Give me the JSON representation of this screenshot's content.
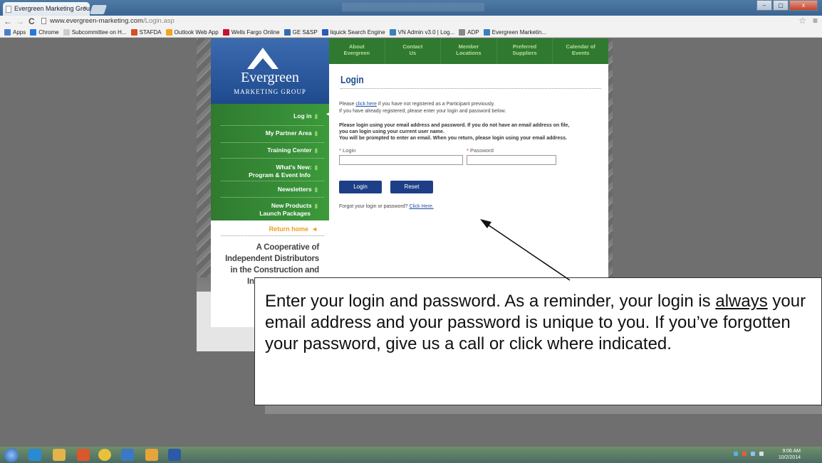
{
  "browser": {
    "tab_title": "Evergreen Marketing Grou",
    "tab_close": "×",
    "back": "←",
    "forward": "→",
    "reload": "C",
    "url_host": "www.evergreen-marketing.com",
    "url_path": "/Login.asp",
    "star": "☆",
    "menu": "≡",
    "win_minimize": "–",
    "win_maximize": "▢",
    "win_close": "x"
  },
  "bookmarks": [
    {
      "label": "Apps",
      "color": "#4a7bd0"
    },
    {
      "label": "Chrome",
      "color": "#2a78d6"
    },
    {
      "label": "Subcommittee on H...",
      "color": "#cccccc"
    },
    {
      "label": "STAFDA",
      "color": "#d44e2a"
    },
    {
      "label": "Outlook Web App",
      "color": "#f3a41c"
    },
    {
      "label": "Wells Fargo Online",
      "color": "#c8102e"
    },
    {
      "label": "GE S&SP",
      "color": "#2f6db0"
    },
    {
      "label": "liquick Search Engine",
      "color": "#2a5bb8"
    },
    {
      "label": "VN Admin v3.0 | Log...",
      "color": "#3a7fc0"
    },
    {
      "label": "ADP",
      "color": "#888888"
    },
    {
      "label": "Evergreen Marketin...",
      "color": "#3a7fc0"
    }
  ],
  "logo": {
    "title": "Evergreen",
    "subtitle": "MARKETING GROUP"
  },
  "top_nav": [
    {
      "line1": "About",
      "line2": "Evergreen"
    },
    {
      "line1": "Contact",
      "line2": "Us"
    },
    {
      "line1": "Member",
      "line2": "Locations"
    },
    {
      "line1": "Preferred",
      "line2": "Suppliers"
    },
    {
      "line1": "Calendar of",
      "line2": "Events"
    }
  ],
  "side_menu": [
    {
      "label": "Log in"
    },
    {
      "label": "My Partner Area"
    },
    {
      "label": "Training Center"
    },
    {
      "label": "What's New:",
      "label2": "Program & Event Info"
    },
    {
      "label": "Newsletters"
    },
    {
      "label": "New Products",
      "label2": "Launch Packages"
    }
  ],
  "return_home": "Return home",
  "tagline": "A Cooperative of Independent Distributors in the Construction and Industrial Products",
  "login": {
    "title": "Login",
    "para1_pre": "Please ",
    "para1_link": "click here",
    "para1_post": " if you have not registered as a Participant previously.",
    "para2": "If you have already registered, please enter your login and password below.",
    "bold1": "Please login using your email address and password. If you do not have an email address on file,",
    "bold2": "you can login using your current user name.",
    "bold3": "You will be prompted to enter an email. When you return, please login using your email address.",
    "required_mark": "*",
    "login_label": "Login",
    "password_label": "Password",
    "login_button": "Login",
    "reset_button": "Reset",
    "forgot_pre": "Forgot your login or password? ",
    "forgot_link": "Click Here."
  },
  "callout": {
    "text1": "Enter your login and password. As a reminder, your login is ",
    "emphasis": "always",
    "text2": " your email address and your password is unique to you. If you’ve forgotten your password, give us a call or click where indicated."
  },
  "tray": {
    "time": "9:06 AM",
    "date": "10/2/2014"
  }
}
